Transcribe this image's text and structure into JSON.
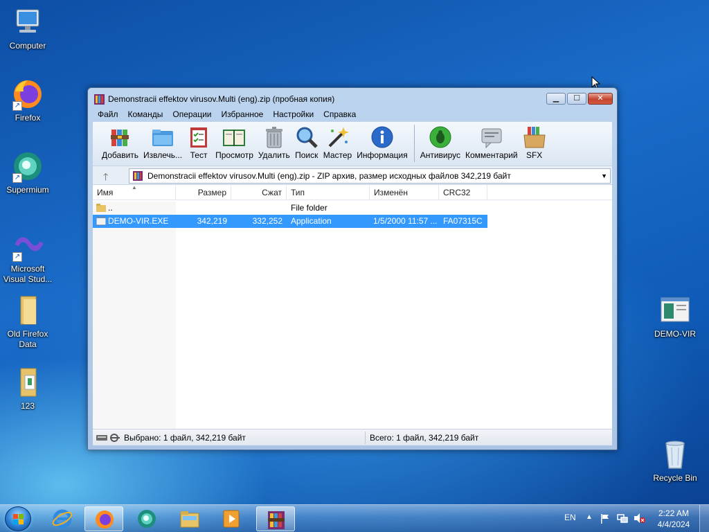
{
  "desktop": {
    "icons": [
      {
        "label": "Computer",
        "icon": "computer-icon"
      },
      {
        "label": "Firefox",
        "icon": "firefox-icon"
      },
      {
        "label": "Supermium",
        "icon": "supermium-icon"
      },
      {
        "label": "Microsoft Visual Stud...",
        "icon": "visual-studio-icon"
      },
      {
        "label": "Old Firefox Data",
        "icon": "folder-icon"
      },
      {
        "label": "123",
        "icon": "folder-icon"
      },
      {
        "label": "DEMO-VIR",
        "icon": "executable-icon"
      },
      {
        "label": "Recycle Bin",
        "icon": "recycle-bin-icon"
      }
    ]
  },
  "window": {
    "title": "Demonstracii effektov virusov.Multi (eng).zip (пробная копия)",
    "menu": [
      "Файл",
      "Команды",
      "Операции",
      "Избранное",
      "Настройки",
      "Справка"
    ],
    "toolbar": [
      {
        "label": "Добавить",
        "icon": "add-archive-icon"
      },
      {
        "label": "Извлечь...",
        "icon": "extract-icon"
      },
      {
        "label": "Тест",
        "icon": "test-icon"
      },
      {
        "label": "Просмотр",
        "icon": "view-icon"
      },
      {
        "label": "Удалить",
        "icon": "delete-icon"
      },
      {
        "label": "Поиск",
        "icon": "find-icon"
      },
      {
        "label": "Мастер",
        "icon": "wizard-icon"
      },
      {
        "label": "Информация",
        "icon": "info-icon"
      },
      {
        "label": "Антивирус",
        "icon": "antivirus-icon"
      },
      {
        "label": "Комментарий",
        "icon": "comment-icon"
      },
      {
        "label": "SFX",
        "icon": "sfx-icon"
      }
    ],
    "address": "Demonstracii effektov virusov.Multi (eng).zip - ZIP архив, размер исходных файлов 342,219 байт",
    "columns": {
      "name": "Имя",
      "size": "Размер",
      "packed": "Сжат",
      "type": "Тип",
      "modified": "Изменён",
      "crc": "CRC32"
    },
    "rows": [
      {
        "name": "..",
        "size": "",
        "packed": "",
        "type": "File folder",
        "modified": "",
        "crc": "",
        "selected": false
      },
      {
        "name": "DEMO-VIR.EXE",
        "size": "342,219",
        "packed": "332,252",
        "type": "Application",
        "modified": "1/5/2000 11:57 ...",
        "crc": "FA07315C",
        "selected": true
      }
    ],
    "status": {
      "selected": "Выбрано: 1 файл, 342,219 байт",
      "total": "Всего: 1 файл, 342,219 байт"
    }
  },
  "taskbar": {
    "apps": [
      "internet-explorer-icon",
      "firefox-icon",
      "supermium-icon",
      "explorer-icon",
      "media-player-icon",
      "winrar-icon"
    ],
    "language": "EN",
    "time": "2:22 AM",
    "date": "4/4/2024"
  },
  "colors": {
    "selection": "#3399ff",
    "accent": "#1a6cc8"
  }
}
